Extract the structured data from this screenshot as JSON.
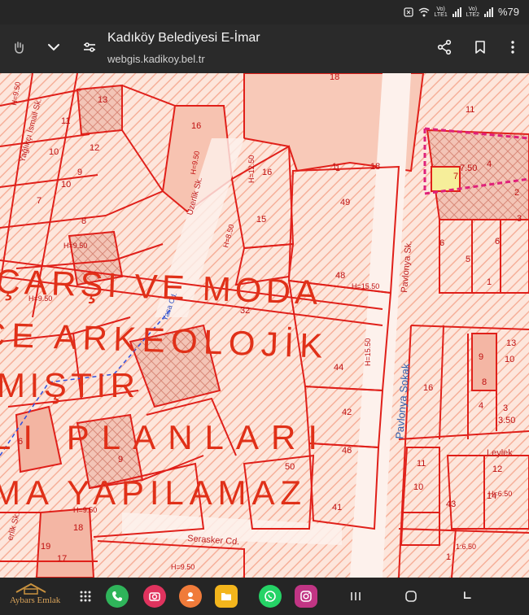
{
  "status": {
    "net1_top": "Vo)",
    "net1_bottom": "LTE1",
    "net2_top": "Vo)",
    "net2_bottom": "LTE2",
    "battery": "%79"
  },
  "toolbar": {
    "title": "Kadıköy Belediyesi E-İmar",
    "url": "webgis.kadikoy.bel.tr"
  },
  "map": {
    "overlay_lines": [
      "ÇARŞI VE MODA",
      "CE  ARKEOLOJİK",
      "MIŞTIR",
      "LI   PLANLARI",
      "MA YAPILAMAZ"
    ],
    "streets": [
      "Yağlıkçı İsmail Sk.",
      "Üzerlik Sk.",
      "Pavlonya Sk.",
      "Pavlonya Sokak",
      "Serasker Cd.",
      "Leylek",
      "Yasa Cd.",
      "erlik Sk."
    ],
    "parcels": [
      "18",
      "13",
      "16",
      "11",
      "12",
      "10",
      "7",
      "9",
      "8",
      "10",
      "11",
      "1",
      "6",
      "15",
      "16",
      "49",
      "48",
      "32",
      "44",
      "42",
      "46",
      "50",
      "41",
      "43",
      "14",
      "12",
      "13",
      "9",
      "3",
      "4",
      "16",
      "10",
      "8",
      "5",
      "6",
      "4",
      "2",
      "3",
      "7",
      "11",
      "1",
      "17",
      "18",
      "19",
      "6",
      "9",
      "10"
    ],
    "heights": [
      "H=9.50",
      "H=12.50",
      "H=9.50",
      "H=15.50",
      "H=15.50",
      "H=9.50",
      "H=9.50",
      "H=8.50",
      "H=6.50",
      "H=9.50",
      "H=9.50",
      "1:6.50"
    ],
    "misc": [
      "1",
      "1",
      "18",
      "3.50",
      "7.50"
    ]
  },
  "navbar": {
    "logo_text": "Aybars Emlak"
  },
  "colors": {
    "map_fill": "#fde3d8",
    "parcel_line": "#e0201a",
    "overlay_text": "#e03018",
    "hatch": "#f5a48c"
  }
}
